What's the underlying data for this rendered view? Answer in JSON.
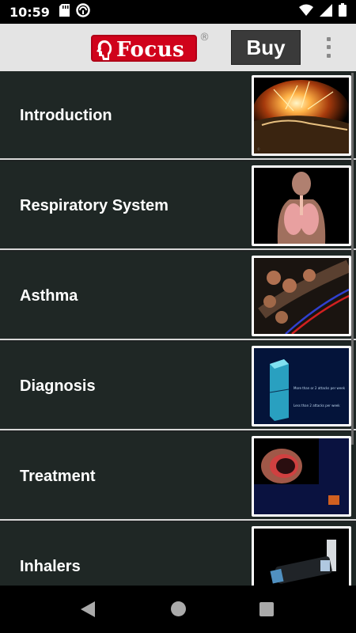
{
  "status_bar": {
    "time": "10:59",
    "icons_left": [
      "sd-card-icon",
      "no-disturb-icon"
    ],
    "icons_right": [
      "wifi-icon",
      "signal-icon",
      "battery-icon"
    ]
  },
  "app_bar": {
    "logo_text": "Focus",
    "logo_registered": "®",
    "buy_label": "Buy",
    "menu_icon": "overflow-menu-icon"
  },
  "topics": [
    {
      "label": "Introduction",
      "thumbnail": "globe-explosion"
    },
    {
      "label": "Respiratory System",
      "thumbnail": "human-torso-lungs"
    },
    {
      "label": "Asthma",
      "thumbnail": "alveoli"
    },
    {
      "label": "Diagnosis",
      "thumbnail": "chart-column"
    },
    {
      "label": "Treatment",
      "thumbnail": "airway-cross-section"
    },
    {
      "label": "Inhalers",
      "thumbnail": "inhaler-device"
    }
  ],
  "thumbnail_captions": {
    "diagnosis_line1": "More than or 2 attacks per week",
    "diagnosis_line2": "Less than 2 attacks per week"
  },
  "colors": {
    "list_bg": "#1f2725",
    "divider": "#d8d8d8",
    "app_bar_bg": "#e4e4e4",
    "logo_red": "#d0021b",
    "buy_bg": "#3a3a3a"
  },
  "nav_bar": {
    "back_icon": "back-icon",
    "home_icon": "home-icon",
    "recent_icon": "recent-apps-icon"
  }
}
